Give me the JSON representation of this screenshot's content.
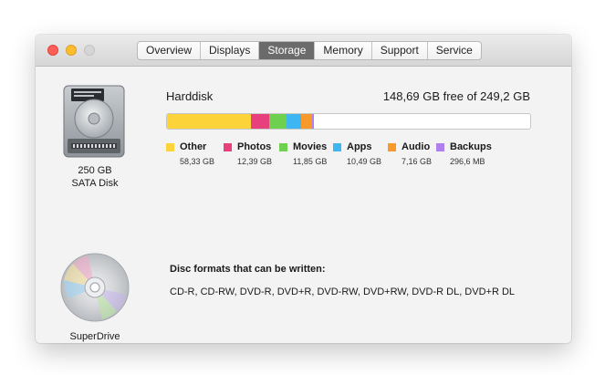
{
  "window": {
    "tabs": [
      {
        "label": "Overview"
      },
      {
        "label": "Displays"
      },
      {
        "label": "Storage"
      },
      {
        "label": "Memory"
      },
      {
        "label": "Support"
      },
      {
        "label": "Service"
      }
    ],
    "active_tab": "Storage"
  },
  "harddisk": {
    "name": "Harddisk",
    "free_text": "148,69 GB free of 249,2 GB",
    "size_label": "250 GB",
    "type_label": "SATA Disk",
    "used_fraction": 0.4,
    "categories": [
      {
        "name": "Other",
        "size": "58,33 GB",
        "gb": 58.33,
        "color": "#fdd33a"
      },
      {
        "name": "Photos",
        "size": "12,39 GB",
        "gb": 12.39,
        "color": "#e8407d"
      },
      {
        "name": "Movies",
        "size": "11,85 GB",
        "gb": 11.85,
        "color": "#6dd04e"
      },
      {
        "name": "Apps",
        "size": "10,49 GB",
        "gb": 10.49,
        "color": "#3db6f1"
      },
      {
        "name": "Audio",
        "size": "7,16 GB",
        "gb": 7.16,
        "color": "#f79a2b"
      },
      {
        "name": "Backups",
        "size": "296,6 MB",
        "gb": 0.3,
        "color": "#b080ec"
      }
    ],
    "total_gb": 249.2
  },
  "superdrive": {
    "label": "SuperDrive",
    "formats_title": "Disc formats that can be written:",
    "formats": "CD-R, CD-RW, DVD-R, DVD+R, DVD-RW, DVD+RW, DVD-R DL, DVD+R DL"
  },
  "icons": {
    "close": "close-icon",
    "minimize": "minimize-icon",
    "zoom": "zoom-icon",
    "harddisk": "hard-disk-icon",
    "superdrive": "optical-disc-icon"
  }
}
